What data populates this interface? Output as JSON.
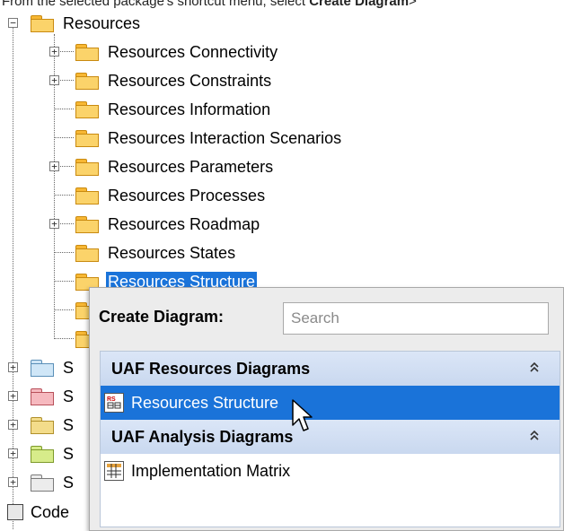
{
  "caption": {
    "text": "From the selected package's shortcut menu, select ",
    "bold": "Create Diagram",
    "suffix": ">"
  },
  "tree": {
    "root": {
      "label": "Resources",
      "expander": "−"
    },
    "children": [
      {
        "label": "Resources Connectivity",
        "expander": "+"
      },
      {
        "label": "Resources Constraints",
        "expander": "+"
      },
      {
        "label": "Resources Information",
        "expander": ""
      },
      {
        "label": "Resources Interaction Scenarios",
        "expander": ""
      },
      {
        "label": "Resources Parameters",
        "expander": "+"
      },
      {
        "label": "Resources Processes",
        "expander": ""
      },
      {
        "label": "Resources Roadmap",
        "expander": "+"
      },
      {
        "label": "Resources States",
        "expander": ""
      },
      {
        "label": "Resources Structure",
        "expander": "",
        "selected": true
      }
    ],
    "siblings": [
      {
        "label": "S",
        "expander": "+",
        "color": "#cfe6f7",
        "border": "#5a8fb8"
      },
      {
        "label": "S",
        "expander": "+",
        "color": "#f6b9bf",
        "border": "#b8505a"
      },
      {
        "label": "S",
        "expander": "+",
        "color": "#f3dc8a",
        "border": "#b0902c"
      },
      {
        "label": "S",
        "expander": "+",
        "color": "#d7ec8a",
        "border": "#7d9a2a"
      },
      {
        "label": "S",
        "expander": "+",
        "color": "#ececec",
        "border": "#7a7a7a"
      }
    ],
    "code_label": "Code"
  },
  "popup": {
    "title": "Create Diagram:",
    "search_placeholder": "Search",
    "groups": [
      {
        "label": "UAF Resources Diagrams",
        "collapse_icon": "double-chevron-up-icon",
        "items": [
          {
            "label": "Resources Structure",
            "selected": true,
            "icon": "resources-structure-diagram-icon"
          }
        ]
      },
      {
        "label": "UAF Analysis Diagrams",
        "collapse_icon": "double-chevron-up-icon",
        "items": [
          {
            "label": "Implementation Matrix",
            "selected": false,
            "icon": "implementation-matrix-icon"
          }
        ]
      }
    ]
  },
  "colors": {
    "selection": "#1a73d9",
    "group_header": "#c9d8ef",
    "folder": "#fbd36a"
  }
}
